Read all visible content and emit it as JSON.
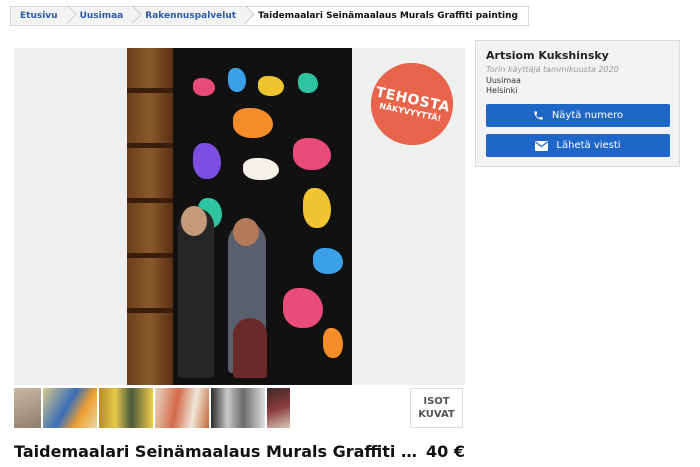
{
  "breadcrumb": [
    {
      "label": "Etusivu"
    },
    {
      "label": "Uusimaa"
    },
    {
      "label": "Rakennuspalvelut"
    },
    {
      "label": "Taidemaalari Seinämaalaus Murals Graffiti painting"
    }
  ],
  "boost_badge": {
    "line1": "TEHOSTA",
    "line2": "NÄKYVYYTTÄ!"
  },
  "thumbnails": [
    "thumb-1",
    "thumb-2",
    "thumb-3",
    "thumb-4",
    "thumb-5",
    "thumb-6"
  ],
  "big_images": {
    "line1": "ISOT",
    "line2": "KUVAT"
  },
  "listing": {
    "title": "Taidemaalari Seinämaalaus Murals Graffiti painting",
    "price": "40 €"
  },
  "seller": {
    "name": "Artsiom Kukshinsky",
    "since": "Torin käyttäjä tammikuusta 2020",
    "region": "Uusimaa",
    "city": "Helsinki",
    "phone_button": "Näytä numero",
    "message_button": "Lähetä viesti",
    "phone_icon": "phone-icon",
    "message_icon": "envelope-icon"
  },
  "colors": {
    "accent": "#1e66c7",
    "badge": "#e8644a",
    "link": "#2a5da8"
  }
}
